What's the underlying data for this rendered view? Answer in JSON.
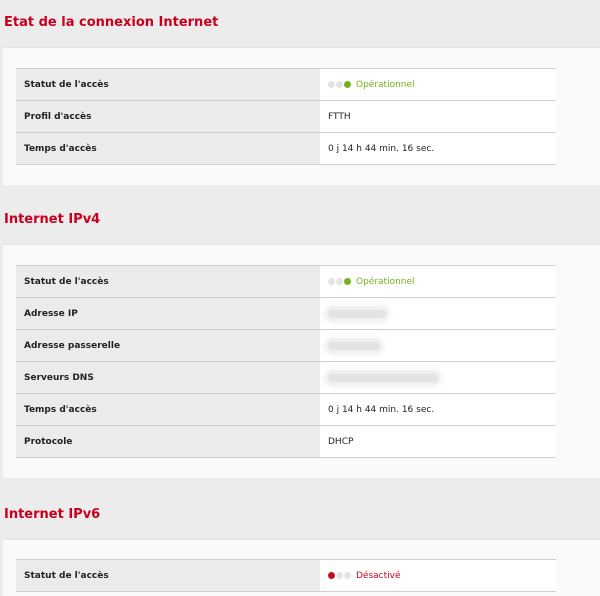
{
  "colors": {
    "accent": "#c8001e",
    "ok": "#74b21a",
    "off": "#d0021b",
    "inactive_dot": "#e3e3e3"
  },
  "sections": [
    {
      "title": "Etat de la connexion Internet",
      "rows": [
        {
          "label": "Statut de l'accès",
          "status": "ok",
          "value": "Opérationnel",
          "dot_icons": [
            "inactive-dot-icon",
            "inactive-dot-icon",
            "green-dot-icon"
          ]
        },
        {
          "label": "Profil d'accès",
          "value": "FTTH"
        },
        {
          "label": "Temps d'accès",
          "value": "0 j 14 h 44 min. 16 sec."
        }
      ]
    },
    {
      "title": "Internet IPv4",
      "rows": [
        {
          "label": "Statut de l'accès",
          "status": "ok",
          "value": "Opérationnel",
          "dot_icons": [
            "inactive-dot-icon",
            "inactive-dot-icon",
            "green-dot-icon"
          ]
        },
        {
          "label": "Adresse IP",
          "value": "",
          "redacted": true
        },
        {
          "label": "Adresse passerelle",
          "value": "",
          "redacted": true
        },
        {
          "label": "Serveurs DNS",
          "value": "",
          "redacted": true
        },
        {
          "label": "Temps d'accès",
          "value": "0 j 14 h 44 min. 16 sec."
        },
        {
          "label": "Protocole",
          "value": "DHCP"
        }
      ]
    },
    {
      "title": "Internet IPv6",
      "rows": [
        {
          "label": "Statut de l'accès",
          "status": "off",
          "value": "Désactivé",
          "dot_icons": [
            "red-dot-icon",
            "inactive-dot-icon",
            "inactive-dot-icon"
          ]
        }
      ]
    }
  ]
}
